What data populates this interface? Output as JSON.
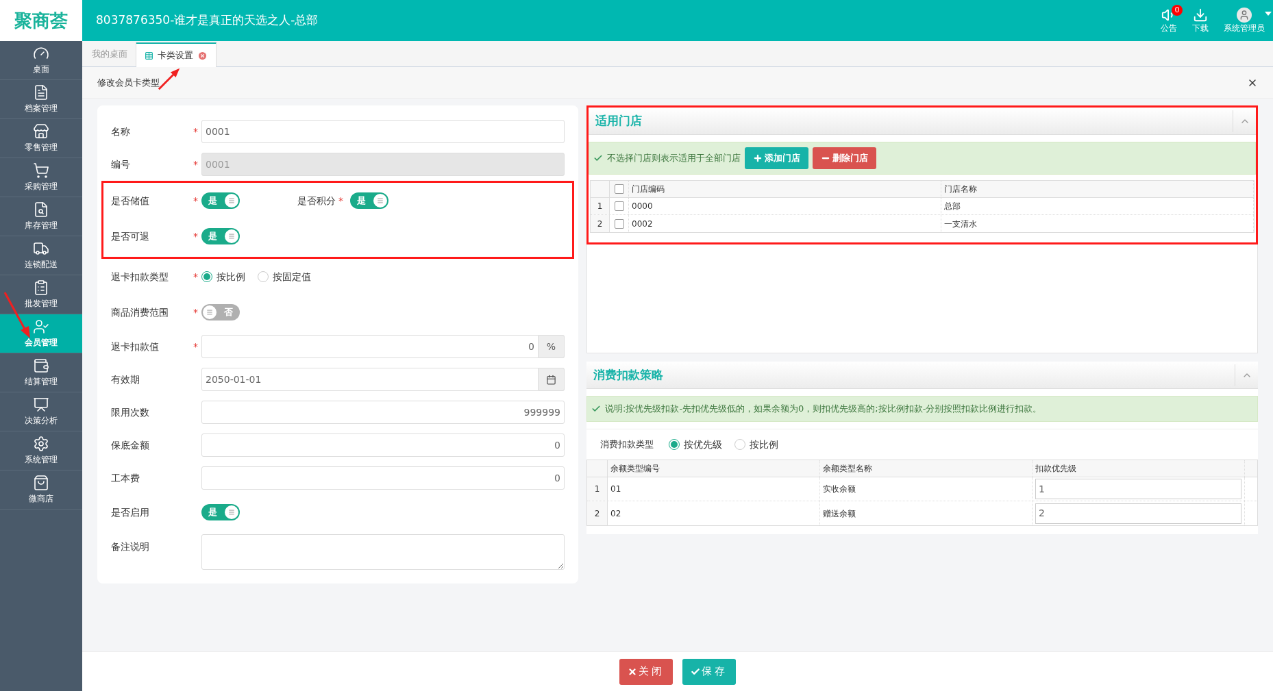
{
  "header": {
    "logo": "聚商荟",
    "title": "8037876350-谁才是真正的天选之人-总部",
    "actions": [
      {
        "kind": "notice",
        "label": "公告",
        "badge": "0"
      },
      {
        "kind": "download",
        "label": "下载"
      },
      {
        "kind": "user",
        "label": "系统管理员"
      }
    ]
  },
  "sidebar": {
    "items": [
      {
        "kind": "dashboard",
        "label": "桌面",
        "selected": false
      },
      {
        "kind": "archive",
        "label": "档案管理",
        "selected": false
      },
      {
        "kind": "retail",
        "label": "零售管理",
        "selected": false
      },
      {
        "kind": "purchase",
        "label": "采购管理",
        "selected": false
      },
      {
        "kind": "stock",
        "label": "库存管理",
        "selected": false
      },
      {
        "kind": "delivery",
        "label": "连锁配送",
        "selected": false
      },
      {
        "kind": "wholesale",
        "label": "批发管理",
        "selected": false
      },
      {
        "kind": "member",
        "label": "会员管理",
        "selected": true
      },
      {
        "kind": "settle",
        "label": "结算管理",
        "selected": false
      },
      {
        "kind": "analysis",
        "label": "决策分析",
        "selected": false
      },
      {
        "kind": "system",
        "label": "系统管理",
        "selected": false
      },
      {
        "kind": "shop",
        "label": "微商店",
        "selected": false
      }
    ]
  },
  "tabs": [
    {
      "label": "我的桌面",
      "selected": false,
      "closable": false
    },
    {
      "label": "卡类设置",
      "selected": true,
      "closable": true
    }
  ],
  "dialog": {
    "title": "修改会员卡类型"
  },
  "form": {
    "sections": [
      {
        "kind": "plain",
        "rows": [
          {
            "kind": "text",
            "label": "名称",
            "mark": "*",
            "value": "0001",
            "disabled": false
          },
          {
            "kind": "text",
            "label": "编号",
            "mark": "*",
            "value": "0001",
            "disabled": true
          }
        ]
      },
      {
        "kind": "highlighted",
        "rows": [
          {
            "kind": "toggles",
            "items": [
              {
                "label": "是否储值",
                "mark": "*",
                "on": true,
                "text": "是"
              },
              {
                "label": "是否积分",
                "mark": "*",
                "on": true,
                "text": "是"
              }
            ]
          },
          {
            "kind": "toggles",
            "items": [
              {
                "label": "是否可退",
                "mark": "*",
                "on": true,
                "text": "是"
              }
            ]
          }
        ]
      },
      {
        "kind": "plain",
        "rows": [
          {
            "kind": "radio",
            "label": "退卡扣款类型",
            "mark": "*",
            "options": [
              {
                "label": "按比例",
                "selected": true
              },
              {
                "label": "按固定值",
                "selected": false
              }
            ]
          },
          {
            "kind": "toggles",
            "items": [
              {
                "label": "商品消费范围",
                "mark": "*",
                "on": false,
                "text": "否"
              }
            ]
          },
          {
            "kind": "suffix",
            "label": "退卡扣款值",
            "mark": "*",
            "value": "0",
            "suffix": "%"
          },
          {
            "kind": "date",
            "label": "有效期",
            "value": "2050-01-01"
          },
          {
            "kind": "number",
            "label": "限用次数",
            "value": "999999"
          },
          {
            "kind": "number",
            "label": "保底金额",
            "value": "0"
          },
          {
            "kind": "number",
            "label": "工本费",
            "value": "0"
          },
          {
            "kind": "toggles",
            "items": [
              {
                "label": "是否启用",
                "on": true,
                "text": "是"
              }
            ]
          },
          {
            "kind": "textarea",
            "label": "备注说明"
          }
        ]
      }
    ]
  },
  "stores": {
    "title": "适用门店",
    "highlighted": true,
    "notice": "不选择门店则表示适用于全部门店",
    "buttons": [
      {
        "kind": "add",
        "label": "添加门店"
      },
      {
        "kind": "delete",
        "label": "删除门店"
      }
    ],
    "columns": [
      "门店编码",
      "门店名称"
    ],
    "all_checked": false,
    "rows": [
      {
        "index": "1",
        "checked": false,
        "cells": [
          "0000",
          "总部"
        ]
      },
      {
        "index": "2",
        "checked": false,
        "cells": [
          "0002",
          "一支清水"
        ]
      }
    ]
  },
  "strategy": {
    "title": "消费扣款策略",
    "notice": "说明:按优先级扣款-先扣优先级低的，如果余额为0，则扣优先级高的;按比例扣款-分别按照扣款比例进行扣款。",
    "type_label": "消费扣款类型",
    "options": [
      {
        "label": "按优先级",
        "selected": true
      },
      {
        "label": "按比例",
        "selected": false
      }
    ],
    "columns": [
      "余额类型编号",
      "余额类型名称",
      "扣款优先级"
    ],
    "rows": [
      {
        "index": "1",
        "code": "01",
        "name": "实收余额",
        "priority": "1"
      },
      {
        "index": "2",
        "code": "02",
        "name": "赠送余额",
        "priority": "2"
      }
    ]
  },
  "footer": {
    "buttons": [
      {
        "kind": "close",
        "label": "关闭"
      },
      {
        "kind": "save",
        "label": "保存"
      }
    ]
  }
}
